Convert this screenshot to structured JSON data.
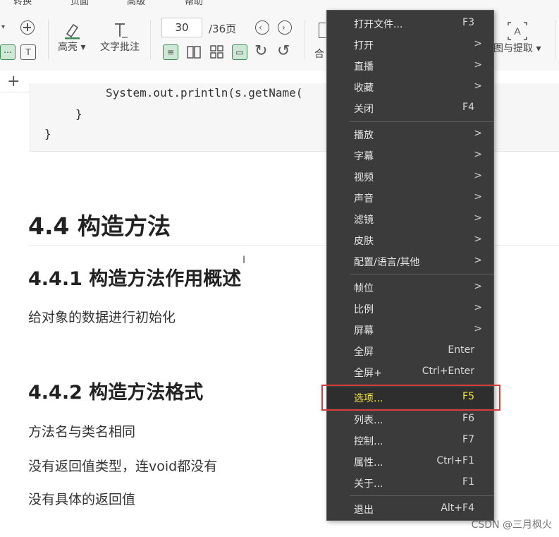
{
  "toolbar": {
    "menu_tabs": [
      "转换",
      "页面",
      "高级",
      "帮助"
    ],
    "highlight_label": "高亮",
    "text_comment_label": "文字批注",
    "page_current": "30",
    "page_total": "/36页",
    "merge_label_partial": "合",
    "extract_label": "图与提取",
    "new_tab": "+"
  },
  "code": {
    "line1": "System.out.println(s.getName(",
    "line2": "}",
    "line3": "}"
  },
  "doc": {
    "h_4_4": "4.4 构造方法",
    "h_4_4_1": "4.4.1 构造方法作用概述",
    "p_init": "给对象的数据进行初始化",
    "h_4_4_2": "4.4.2 构造方法格式",
    "p1": "方法名与类名相同",
    "p2": "没有返回值类型，连void都没有",
    "p3": "没有具体的返回值"
  },
  "context_menu": {
    "items": [
      {
        "label": "打开文件...",
        "shortcut": "F3"
      },
      {
        "label": "打开",
        "submenu": ">"
      },
      {
        "label": "直播",
        "submenu": ">"
      },
      {
        "label": "收藏",
        "submenu": ">"
      },
      {
        "label": "关闭",
        "shortcut": "F4"
      },
      {
        "label": "播放",
        "submenu": ">"
      },
      {
        "label": "字幕",
        "submenu": ">"
      },
      {
        "label": "视频",
        "submenu": ">"
      },
      {
        "label": "声音",
        "submenu": ">"
      },
      {
        "label": "滤镜",
        "submenu": ">"
      },
      {
        "label": "皮肤",
        "submenu": ">"
      },
      {
        "label": "配置/语言/其他",
        "submenu": ">"
      },
      {
        "label": "帧位",
        "submenu": ">"
      },
      {
        "label": "比例",
        "submenu": ">"
      },
      {
        "label": "屏幕",
        "submenu": ">"
      },
      {
        "label": "全屏",
        "shortcut": "Enter"
      },
      {
        "label": "全屏+",
        "shortcut": "Ctrl+Enter"
      },
      {
        "label": "选项...",
        "shortcut": "F5",
        "highlighted": true
      },
      {
        "label": "列表...",
        "shortcut": "F6"
      },
      {
        "label": "控制...",
        "shortcut": "F7"
      },
      {
        "label": "属性...",
        "shortcut": "Ctrl+F1"
      },
      {
        "label": "关于...",
        "shortcut": "F1"
      },
      {
        "label": "退出",
        "shortcut": "Alt+F4"
      }
    ]
  },
  "watermark": "CSDN @三月枫火",
  "colors": {
    "menu_bg": "#3b3b3b",
    "highlight_text": "#f5e63a",
    "annotation_box": "#d93a3a",
    "active_button": "#cde8d5"
  }
}
